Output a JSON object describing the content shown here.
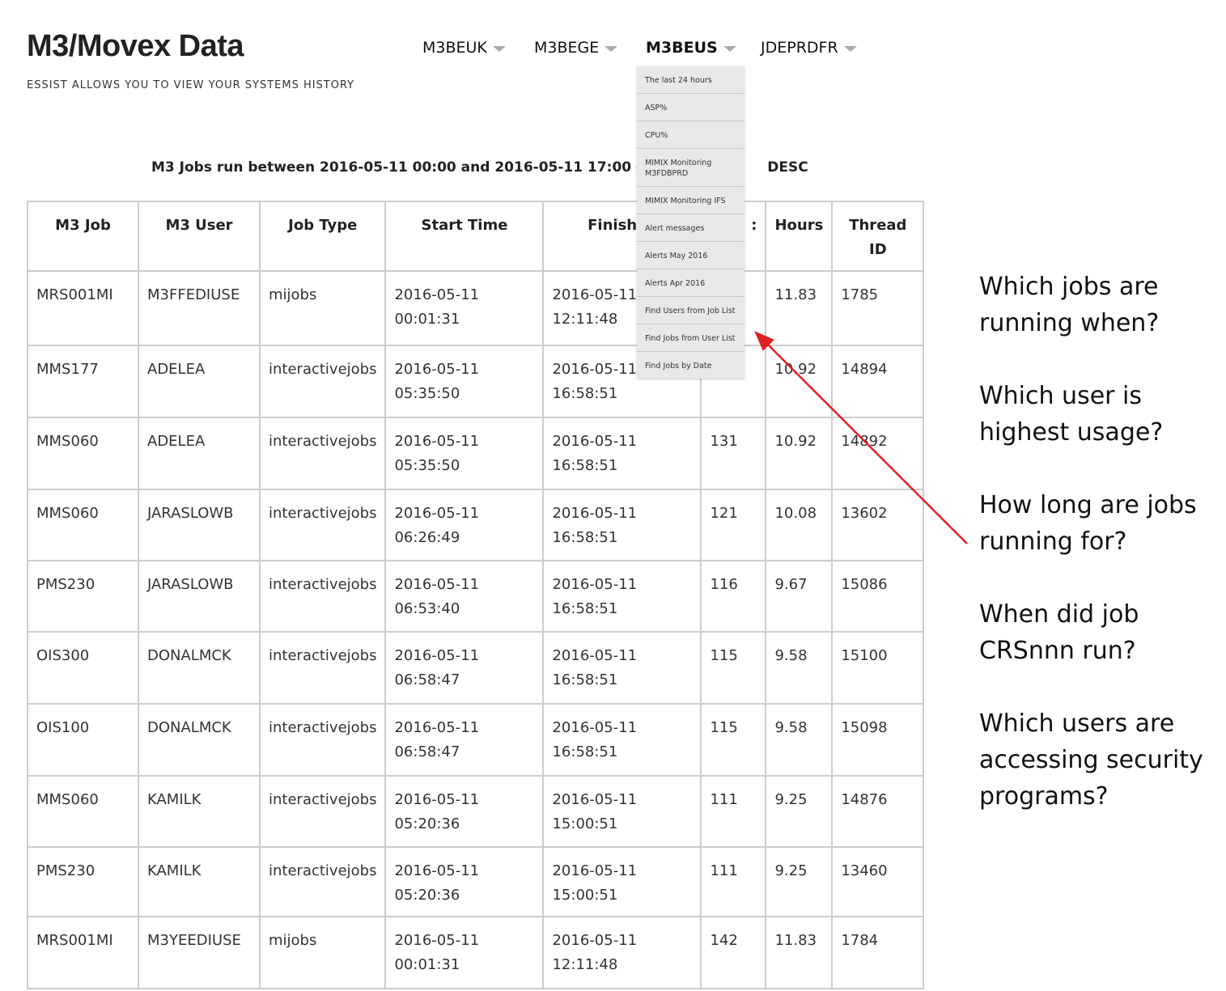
{
  "site": {
    "title": "M3/Movex Data",
    "tagline": "ESSIST ALLOWS YOU TO VIEW YOUR SYSTEMS HISTORY"
  },
  "nav": {
    "items": [
      "M3BEUK",
      "M3BEGE",
      "M3BEUS",
      "JDEPRDFR"
    ],
    "active": "M3BEUS"
  },
  "dropdown": {
    "items": [
      "The last 24 hours",
      "ASP%",
      "CPU%",
      "MIMIX Monitoring M3FDBPRD",
      "MIMIX Monitoring IFS",
      "Alert messages",
      "Alerts May 2016",
      "Alerts Apr 2016",
      "Find Users from Job List",
      "Find Jobs from User List",
      "Find Jobs by Date"
    ]
  },
  "report": {
    "heading_left": "M3 Jobs run between 2016-05-11 00:00 and 2016-05-11 17:00 ord",
    "heading_right": "DESC",
    "heading_fragment": "/",
    "columns": [
      "M3 Job",
      "M3 User",
      "Job Type",
      "Start Time",
      "Finish Ti",
      ":",
      "Hours",
      "Thread ID"
    ],
    "rows": [
      [
        "MRS001MI",
        "M3FFEDIUSE",
        "mijobs",
        "2016-05-11 00:01:31",
        "2016-05-11 12:11:48",
        "",
        "11.83",
        "1785"
      ],
      [
        "MMS177",
        "ADELEA",
        "interactivejobs",
        "2016-05-11 05:35:50",
        "2016-05-11 16:58:51",
        "",
        "10.92",
        "14894"
      ],
      [
        "MMS060",
        "ADELEA",
        "interactivejobs",
        "2016-05-11 05:35:50",
        "2016-05-11 16:58:51",
        "131",
        "10.92",
        "14892"
      ],
      [
        "MMS060",
        "JARASLOWB",
        "interactivejobs",
        "2016-05-11 06:26:49",
        "2016-05-11 16:58:51",
        "121",
        "10.08",
        "13602"
      ],
      [
        "PMS230",
        "JARASLOWB",
        "interactivejobs",
        "2016-05-11 06:53:40",
        "2016-05-11 16:58:51",
        "116",
        "9.67",
        "15086"
      ],
      [
        "OIS300",
        "DONALMCK",
        "interactivejobs",
        "2016-05-11 06:58:47",
        "2016-05-11 16:58:51",
        "115",
        "9.58",
        "15100"
      ],
      [
        "OIS100",
        "DONALMCK",
        "interactivejobs",
        "2016-05-11 06:58:47",
        "2016-05-11 16:58:51",
        "115",
        "9.58",
        "15098"
      ],
      [
        "MMS060",
        "KAMILK",
        "interactivejobs",
        "2016-05-11 05:20:36",
        "2016-05-11 15:00:51",
        "111",
        "9.25",
        "14876"
      ],
      [
        "PMS230",
        "KAMILK",
        "interactivejobs",
        "2016-05-11 05:20:36",
        "2016-05-11 15:00:51",
        "111",
        "9.25",
        "13460"
      ],
      [
        "MRS001MI",
        "M3YEEDIUSE",
        "mijobs",
        "2016-05-11 00:01:31",
        "2016-05-11 12:11:48",
        "142",
        "11.83",
        "1784"
      ]
    ]
  },
  "questions": [
    "Which jobs are running when?",
    "Which user is highest usage?",
    "How long are jobs running for?",
    "When did job CRSnnn run?",
    "Which users are accessing security programs?"
  ],
  "colors": {
    "annotation_arrow": "#e02020",
    "dropdown_bg": "#e8e8e8",
    "table_border": "#cccccc"
  }
}
